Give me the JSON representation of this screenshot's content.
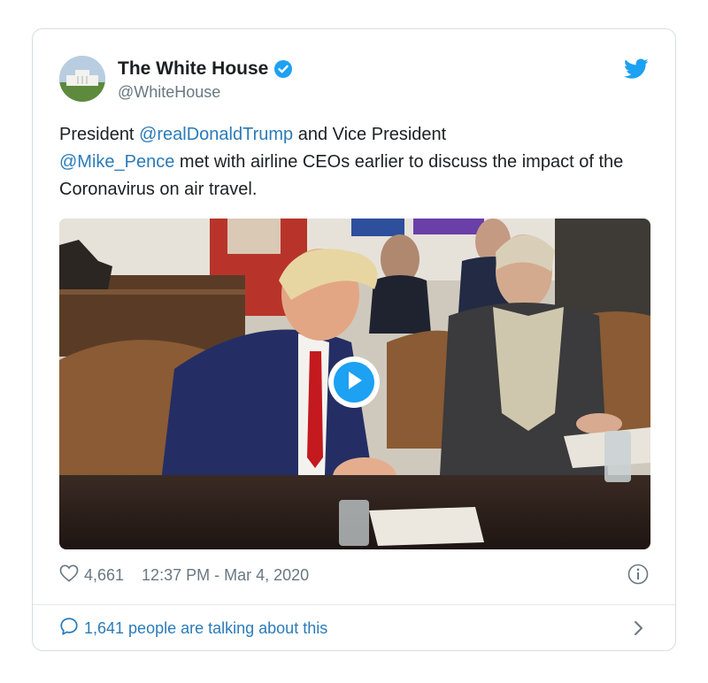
{
  "tweet": {
    "author_name": "The White House",
    "author_handle": "@WhiteHouse",
    "verified": true,
    "text_parts": [
      {
        "text": "President ",
        "mention": false
      },
      {
        "text": "@realDonaldTrump",
        "mention": true
      },
      {
        "text": " and Vice President ",
        "mention": false
      },
      {
        "text": "@Mike_Pence",
        "mention": true
      },
      {
        "text": " met with airline CEOs earlier to discuss the impact of the Coronavirus on air travel.",
        "mention": false
      }
    ],
    "media_type": "video",
    "likes": "4,661",
    "timestamp": "12:37 PM - Mar 4, 2020",
    "talking_label": "1,641 people are talking about this"
  },
  "icons": {
    "verified": "verified-badge-icon",
    "brand": "twitter-bird-icon",
    "play": "play-icon",
    "like": "heart-icon",
    "info": "info-icon",
    "reply": "reply-bubble-icon",
    "chevron": "chevron-right-icon"
  },
  "colors": {
    "accent": "#1da1f2",
    "link": "#2b7bb9",
    "muted": "#697882",
    "text": "#1c2022"
  }
}
